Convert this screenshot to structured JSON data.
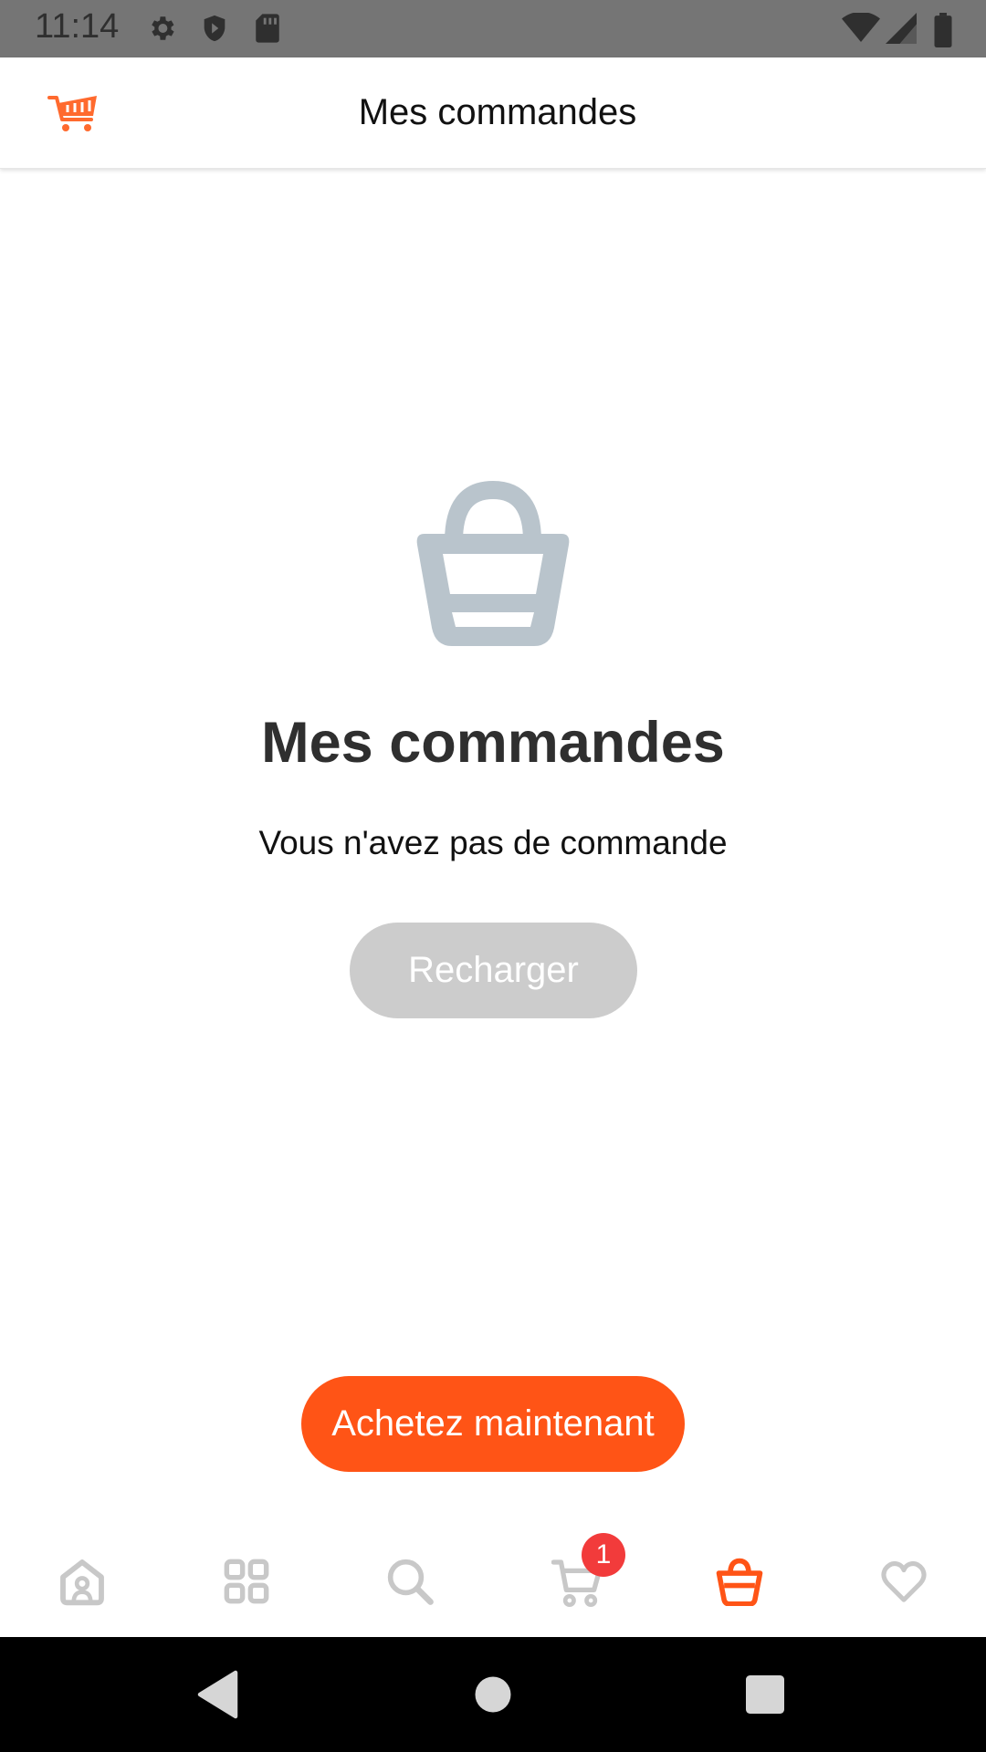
{
  "status_bar": {
    "time": "11:14",
    "icons": [
      "settings-icon",
      "shield-icon",
      "sd-card-icon",
      "wifi-icon",
      "signal-icon",
      "battery-icon"
    ]
  },
  "header": {
    "title": "Mes commandes",
    "logo_icon": "shopping-cart-logo-icon"
  },
  "empty_state": {
    "icon": "basket-icon",
    "title": "Mes commandes",
    "message": "Vous n'avez pas de commande",
    "reload_label": "Recharger"
  },
  "cta": {
    "label": "Achetez maintenant"
  },
  "bottom_nav": {
    "items": [
      {
        "icon": "home-icon",
        "active": false
      },
      {
        "icon": "categories-icon",
        "active": false
      },
      {
        "icon": "search-icon",
        "active": false
      },
      {
        "icon": "cart-icon",
        "active": false
      },
      {
        "icon": "basket-icon",
        "active": true
      },
      {
        "icon": "heart-icon",
        "active": false
      }
    ],
    "cart_badge": "1"
  },
  "system_nav": {
    "icons": [
      "back-icon",
      "home-circle-icon",
      "recents-icon"
    ]
  },
  "colors": {
    "accent": "#ff5416",
    "inactive_icon": "#c8c8c8",
    "empty_icon": "#b9c4cc",
    "disabled_button": "#cccccc",
    "badge": "#f23b3b"
  }
}
